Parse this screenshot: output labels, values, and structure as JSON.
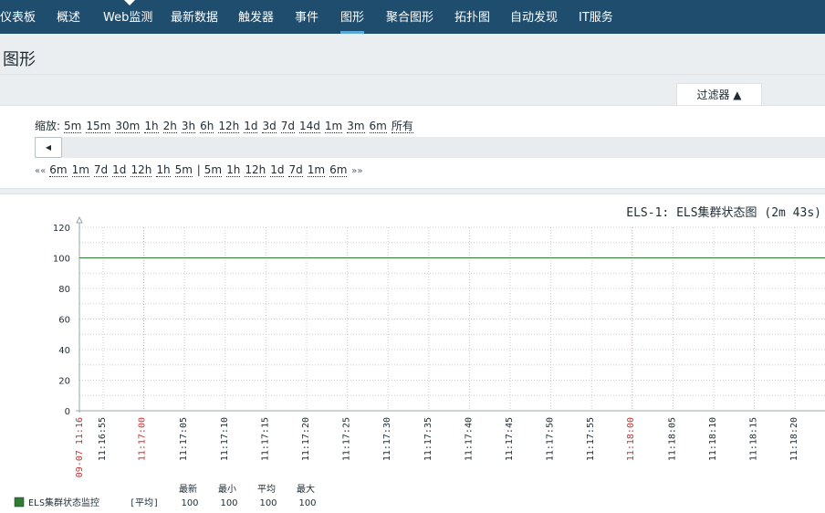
{
  "nav": {
    "items": [
      {
        "label": "仪表板",
        "active": false
      },
      {
        "label": "概述",
        "active": false
      },
      {
        "label": "Web监测",
        "active": false
      },
      {
        "label": "最新数据",
        "active": false
      },
      {
        "label": "触发器",
        "active": false
      },
      {
        "label": "事件",
        "active": false
      },
      {
        "label": "图形",
        "active": true
      },
      {
        "label": "聚合图形",
        "active": false
      },
      {
        "label": "拓扑图",
        "active": false
      },
      {
        "label": "自动发现",
        "active": false
      },
      {
        "label": "IT服务",
        "active": false
      }
    ]
  },
  "page": {
    "title": "图形"
  },
  "filter": {
    "tab_label": "过滤器 ▲",
    "zoom_label": "缩放:",
    "zoom_options": [
      "5m",
      "15m",
      "30m",
      "1h",
      "2h",
      "3h",
      "6h",
      "12h",
      "1d",
      "3d",
      "7d",
      "14d",
      "1m",
      "3m",
      "6m",
      "所有"
    ],
    "back_arrow": "««",
    "back_options": [
      "6m",
      "1m",
      "7d",
      "1d",
      "12h",
      "1h",
      "5m"
    ],
    "separator": "|",
    "forward_options": [
      "5m",
      "1h",
      "12h",
      "1d",
      "7d",
      "1m",
      "6m"
    ],
    "forward_arrow": "»»",
    "scroll_left_glyph": "◀"
  },
  "chart_data": {
    "type": "line",
    "title": "ELS-1: ELS集群状态图 (2m 43s)",
    "ylim": [
      0,
      120
    ],
    "y_ticks": [
      0,
      20,
      40,
      60,
      80,
      100,
      120
    ],
    "x_start_label": "09-07 11:16",
    "x_ticks": [
      {
        "label": "11:16:55",
        "red": false
      },
      {
        "label": "11:17:00",
        "red": true
      },
      {
        "label": "11:17:05",
        "red": false
      },
      {
        "label": "11:17:10",
        "red": false
      },
      {
        "label": "11:17:15",
        "red": false
      },
      {
        "label": "11:17:20",
        "red": false
      },
      {
        "label": "11:17:25",
        "red": false
      },
      {
        "label": "11:17:30",
        "red": false
      },
      {
        "label": "11:17:35",
        "red": false
      },
      {
        "label": "11:17:40",
        "red": false
      },
      {
        "label": "11:17:45",
        "red": false
      },
      {
        "label": "11:17:50",
        "red": false
      },
      {
        "label": "11:17:55",
        "red": false
      },
      {
        "label": "11:18:00",
        "red": true
      },
      {
        "label": "11:18:05",
        "red": false
      },
      {
        "label": "11:18:10",
        "red": false
      },
      {
        "label": "11:18:15",
        "red": false
      },
      {
        "label": "11:18:20",
        "red": false
      }
    ],
    "series": [
      {
        "name": "ELS集群状态监控",
        "color": "#2e7d32",
        "values": [
          100,
          100
        ]
      }
    ],
    "legend": {
      "headers": [
        "最新",
        "最小",
        "平均",
        "最大"
      ],
      "rows": [
        {
          "name": "ELS集群状态监控",
          "func": "[平均]",
          "last": "100",
          "min": "100",
          "avg": "100",
          "max": "100",
          "color": "#2e7d32"
        }
      ]
    }
  }
}
